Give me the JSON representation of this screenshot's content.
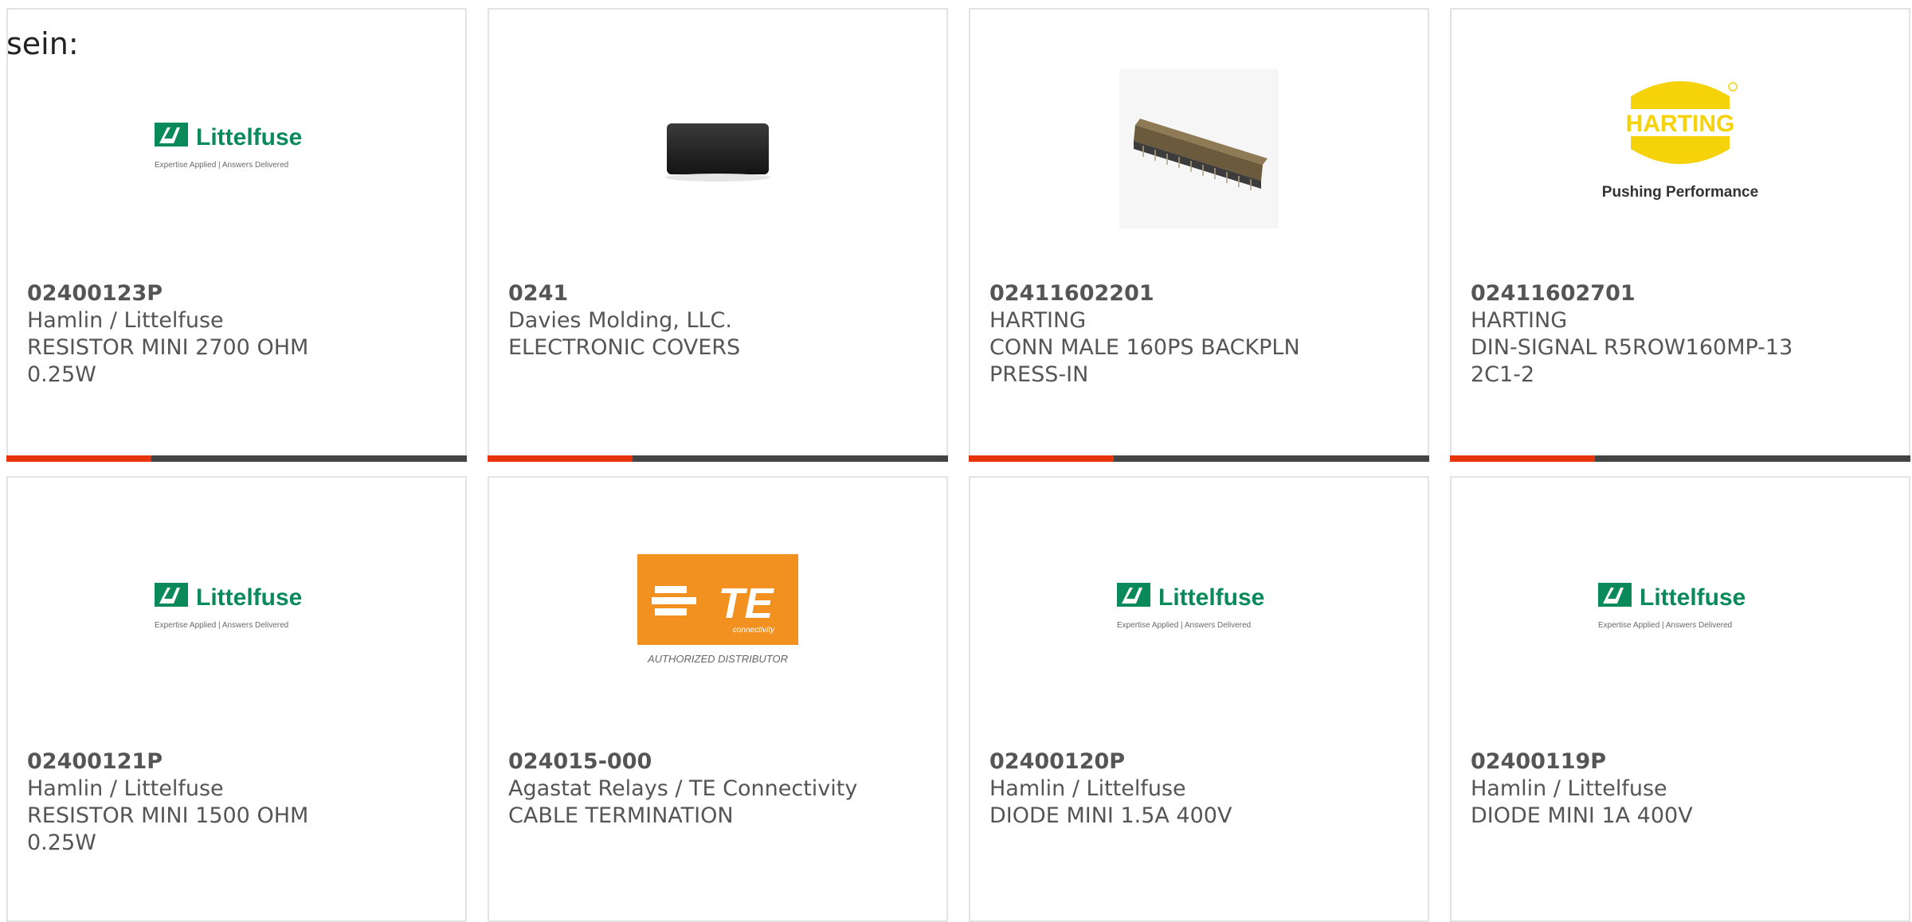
{
  "intro": "sein:",
  "colors": {
    "accent": "#e8340c",
    "bar": "#444444",
    "littelfuse_green": "#0a8a5a",
    "harting_yellow": "#f5d20a",
    "te_orange": "#f29120"
  },
  "logos": {
    "littelfuse": {
      "name": "Littelfuse",
      "tagline": "Expertise Applied | Answers Delivered"
    },
    "harting": {
      "name": "HARTING",
      "tagline": "Pushing Performance"
    },
    "te": {
      "name": "TE",
      "sub": "connectivity",
      "tagline": "AUTHORIZED DISTRIBUTOR"
    }
  },
  "products": [
    {
      "part": "02400123P",
      "maker": "Hamlin / Littelfuse",
      "desc1": "RESISTOR MINI 2700 OHM",
      "desc2": "0.25W",
      "image": "littelfuse-logo"
    },
    {
      "part": "0241",
      "maker": "Davies Molding, LLC.",
      "desc1": "ELECTRONIC COVERS",
      "desc2": "",
      "image": "black-cover-photo"
    },
    {
      "part": "02411602201",
      "maker": "HARTING",
      "desc1": "CONN MALE 160PS BACKPLN",
      "desc2": "PRESS-IN",
      "image": "connector-photo"
    },
    {
      "part": "02411602701",
      "maker": "HARTING",
      "desc1": "DIN-SIGNAL R5ROW160MP-13",
      "desc2": "2C1-2",
      "image": "harting-logo"
    },
    {
      "part": "02400121P",
      "maker": "Hamlin / Littelfuse",
      "desc1": "RESISTOR MINI 1500 OHM",
      "desc2": "0.25W",
      "image": "littelfuse-logo"
    },
    {
      "part": "024015-000",
      "maker": "Agastat Relays / TE Connectivity",
      "desc1": "CABLE TERMINATION",
      "desc2": "",
      "image": "te-logo"
    },
    {
      "part": "02400120P",
      "maker": "Hamlin / Littelfuse",
      "desc1": "DIODE MINI 1.5A 400V",
      "desc2": "",
      "image": "littelfuse-logo"
    },
    {
      "part": "02400119P",
      "maker": "Hamlin / Littelfuse",
      "desc1": "DIODE MINI 1A 400V",
      "desc2": "",
      "image": "littelfuse-logo"
    }
  ]
}
